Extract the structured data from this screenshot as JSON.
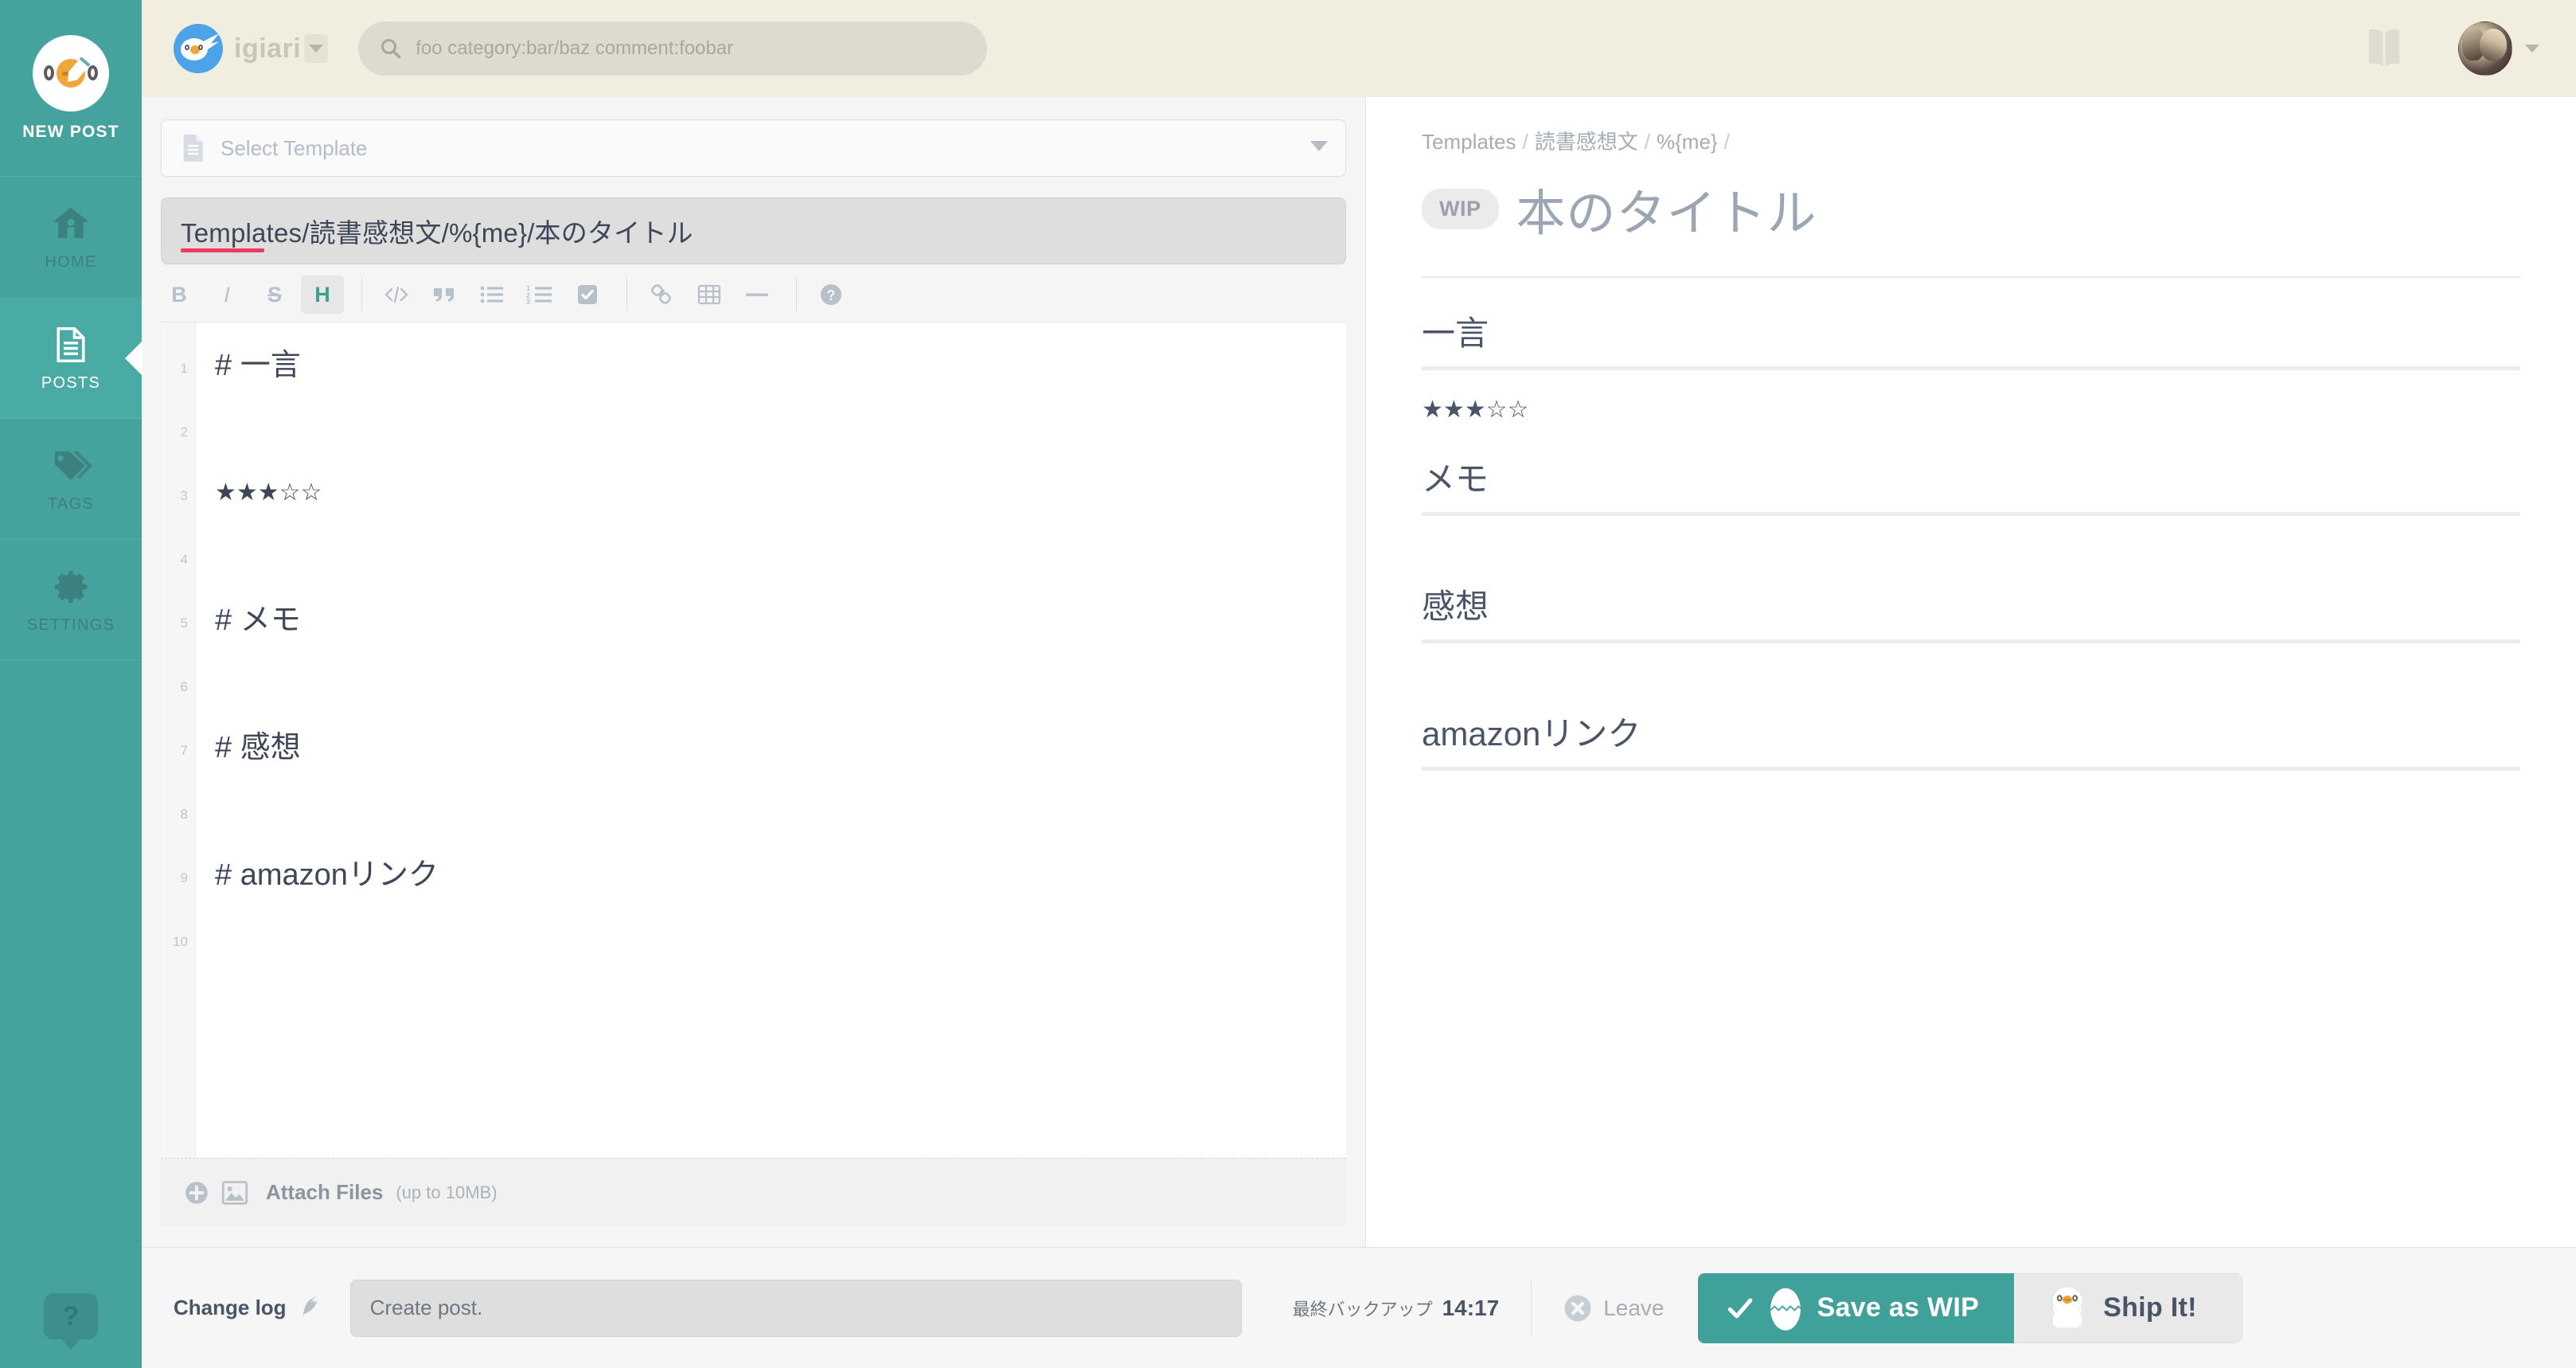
{
  "sidebar": {
    "new_post": {
      "label": "NEW POST",
      "icon": "egg-avatar-pencil-icon"
    },
    "items": [
      {
        "label": "HOME",
        "icon": "home-icon",
        "active": false
      },
      {
        "label": "POSTS",
        "icon": "document-icon",
        "active": true
      },
      {
        "label": "TAGS",
        "icon": "tag-icon",
        "active": false
      },
      {
        "label": "SETTINGS",
        "icon": "gear-icon",
        "active": false
      }
    ],
    "help": {
      "label": "?",
      "icon": "help-balloon-icon"
    }
  },
  "topbar": {
    "brand_name": "igiari",
    "brand_icon": "bird-logo-icon",
    "brand_caret_icon": "chevron-down-icon",
    "search": {
      "placeholder": "foo category:bar/baz comment:foobar",
      "icon": "search-icon"
    },
    "notebook_icon": "book-icon",
    "user_caret_icon": "chevron-down-icon",
    "avatar_icon": "user-avatar"
  },
  "editor": {
    "select_template": {
      "label": "Select Template",
      "icon": "document-icon",
      "caret_icon": "chevron-down-icon"
    },
    "title_value": "Templates/読書感想文/%{me}/本のタイトル",
    "toolbar": [
      {
        "name": "bold",
        "glyph": "B",
        "active": false
      },
      {
        "name": "italic",
        "glyph": "I",
        "active": false
      },
      {
        "name": "strikethrough",
        "glyph": "S",
        "active": false
      },
      {
        "name": "heading",
        "glyph": "H",
        "active": true
      },
      {
        "name": "code",
        "glyph": "</>",
        "active": false
      },
      {
        "name": "quote",
        "glyph": "“",
        "active": false
      },
      {
        "name": "bullet-list",
        "glyph": "",
        "active": false
      },
      {
        "name": "numbered-list",
        "glyph": "",
        "active": false
      },
      {
        "name": "checkbox",
        "glyph": "",
        "active": false
      },
      {
        "name": "link",
        "glyph": "",
        "active": false
      },
      {
        "name": "table",
        "glyph": "",
        "active": false
      },
      {
        "name": "horizontal-rule",
        "glyph": "",
        "active": false
      },
      {
        "name": "help",
        "glyph": "?",
        "active": false
      }
    ],
    "line_numbers": [
      "1",
      "2",
      "3",
      "4",
      "5",
      "6",
      "7",
      "8",
      "9",
      "10"
    ],
    "lines": [
      "# 一言",
      "",
      "★★★☆☆",
      "",
      "# メモ",
      "",
      "# 感想",
      "",
      "# amazonリンク",
      ""
    ],
    "attach": {
      "label": "Attach Files",
      "sub": "(up to 10MB)",
      "plus_icon": "plus-circle-icon",
      "image_icon": "image-icon"
    }
  },
  "preview": {
    "breadcrumb": [
      "Templates",
      "読書感想文",
      "%{me}"
    ],
    "badge": "WIP",
    "title": "本のタイトル",
    "blocks": [
      {
        "type": "heading",
        "text": "一言",
        "rule": true
      },
      {
        "type": "stars",
        "text": "★★★☆☆"
      },
      {
        "type": "heading",
        "text": "メモ",
        "rule": true
      },
      {
        "type": "heading",
        "text": "感想",
        "rule": true
      },
      {
        "type": "heading",
        "text": "amazonリンク",
        "rule": true
      }
    ]
  },
  "bottombar": {
    "changelog_label": "Change log",
    "changelog_icon": "quill-icon",
    "changelog_value": "Create post.",
    "backup_label": "最終バックアップ",
    "backup_time": "14:17",
    "leave": {
      "label": "Leave",
      "icon": "x-circle-icon"
    },
    "save_wip": {
      "label": "Save as WIP",
      "check_icon": "check-icon",
      "egg_icon": "egg-icon"
    },
    "ship_it": {
      "label": "Ship It!",
      "icon": "hatching-chick-icon"
    }
  },
  "colors": {
    "sidebar_teal": "#45a29c",
    "sidebar_active_teal": "#4aaaa4",
    "topbar_cream": "#f1eee0",
    "accent_pink": "#f0395f",
    "heading_green": "#3aa08f",
    "button_teal": "#3fa19a",
    "text_slate": "#3d4757"
  }
}
